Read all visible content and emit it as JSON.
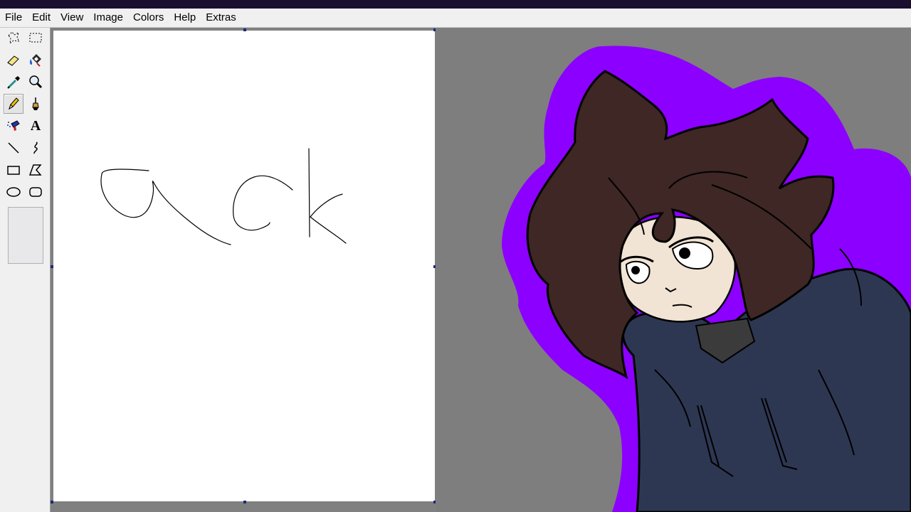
{
  "menu": [
    "File",
    "Edit",
    "View",
    "Image",
    "Colors",
    "Help",
    "Extras"
  ],
  "tools": [
    {
      "name": "free-form-select-icon",
      "active": false
    },
    {
      "name": "rect-select-icon",
      "active": false
    },
    {
      "name": "eraser-icon",
      "active": false
    },
    {
      "name": "fill-bucket-icon",
      "active": false
    },
    {
      "name": "color-picker-icon",
      "active": false
    },
    {
      "name": "magnifier-icon",
      "active": false
    },
    {
      "name": "pencil-icon",
      "active": true
    },
    {
      "name": "brush-icon",
      "active": false
    },
    {
      "name": "airbrush-icon",
      "active": false
    },
    {
      "name": "text-icon",
      "active": false
    },
    {
      "name": "line-icon",
      "active": false
    },
    {
      "name": "curve-icon",
      "active": false
    },
    {
      "name": "rectangle-icon",
      "active": false
    },
    {
      "name": "polygon-icon",
      "active": false
    },
    {
      "name": "ellipse-icon",
      "active": false
    },
    {
      "name": "rounded-rect-icon",
      "active": false
    }
  ],
  "text_tool_glyph": "A",
  "colors": {
    "canvas": "#ffffff",
    "workspace": "#808080",
    "outline": "#8c00ff",
    "hair": "#3e2724",
    "skin": "#f2e4d4",
    "hoodie": "#2e3752",
    "shirt": "#3b3b3b"
  }
}
